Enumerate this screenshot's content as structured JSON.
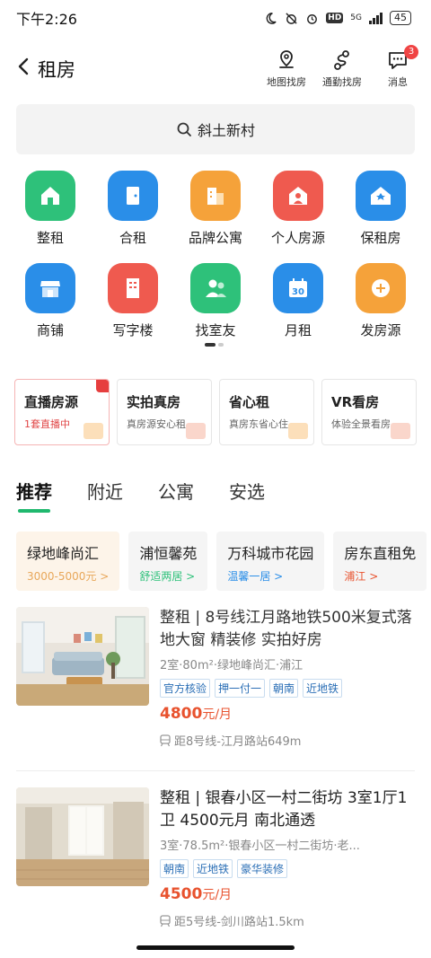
{
  "status_bar": {
    "time": "下午2:26",
    "network": "5G",
    "battery": "45"
  },
  "header": {
    "title": "租房",
    "actions": [
      {
        "label": "地图找房",
        "icon": "map-pin-icon"
      },
      {
        "label": "通勤找房",
        "icon": "route-icon"
      },
      {
        "label": "消息",
        "icon": "message-icon",
        "badge": "3"
      }
    ]
  },
  "search": {
    "text": "斜土新村"
  },
  "categories": [
    {
      "label": "整租",
      "color": "#2ec17a",
      "icon": "house-icon"
    },
    {
      "label": "合租",
      "color": "#2a8ee8",
      "icon": "door-icon"
    },
    {
      "label": "品牌公寓",
      "color": "#f5a23a",
      "icon": "building-icon"
    },
    {
      "label": "个人房源",
      "color": "#ef5a4f",
      "icon": "person-home-icon"
    },
    {
      "label": "保租房",
      "color": "#2a8ee8",
      "icon": "shield-home-icon"
    },
    {
      "label": "商铺",
      "color": "#2a8ee8",
      "icon": "shop-icon"
    },
    {
      "label": "写字楼",
      "color": "#ef5a4f",
      "icon": "office-icon"
    },
    {
      "label": "找室友",
      "color": "#2ec17a",
      "icon": "roommate-icon"
    },
    {
      "label": "月租",
      "color": "#2a8ee8",
      "icon": "calendar-30-icon"
    },
    {
      "label": "发房源",
      "color": "#f5a23a",
      "icon": "plus-icon"
    }
  ],
  "calendar_number": "30",
  "features": [
    {
      "title": "直播房源",
      "sub": "1套直播中"
    },
    {
      "title": "实拍真房",
      "sub": "真房源安心租"
    },
    {
      "title": "省心租",
      "sub": "真房东省心住"
    },
    {
      "title": "VR看房",
      "sub": "体验全景看房"
    }
  ],
  "tabs": [
    "推荐",
    "附近",
    "公寓",
    "安选"
  ],
  "chips": [
    {
      "name": "绿地峰尚汇",
      "sub": "3000-5000元",
      "sub_color": "#e8a75a"
    },
    {
      "name": "浦恒馨苑",
      "sub": "舒适两居",
      "sub_color": "#2ec17a"
    },
    {
      "name": "万科城市花园",
      "sub": "温馨一居",
      "sub_color": "#2a8ee8"
    },
    {
      "name": "房东直租免",
      "sub": "浦江",
      "sub_color": "#e8522e"
    }
  ],
  "chevron": ">",
  "listings": [
    {
      "title": "整租 | 8号线江月路地铁500米复式落地大窗 精装修 实拍好房",
      "detail": "2室·80m²·绿地峰尚汇·浦江",
      "tags": [
        "官方核验",
        "押一付一",
        "朝南",
        "近地铁"
      ],
      "price": "4800",
      "unit": "元/月",
      "metro": "距8号线-江月路站649m"
    },
    {
      "title": "整租 | 银春小区一村二街坊 3室1厅1卫 4500元月 南北通透",
      "detail": "3室·78.5m²·银春小区一村二街坊·老...",
      "tags": [
        "朝南",
        "近地铁",
        "豪华装修"
      ],
      "price": "4500",
      "unit": "元/月",
      "metro": "距5号线-剑川路站1.5km"
    }
  ],
  "colors": {
    "accent_green": "#1fb86e",
    "price_red": "#e8522e",
    "tag_blue": "#2b6fb6"
  }
}
